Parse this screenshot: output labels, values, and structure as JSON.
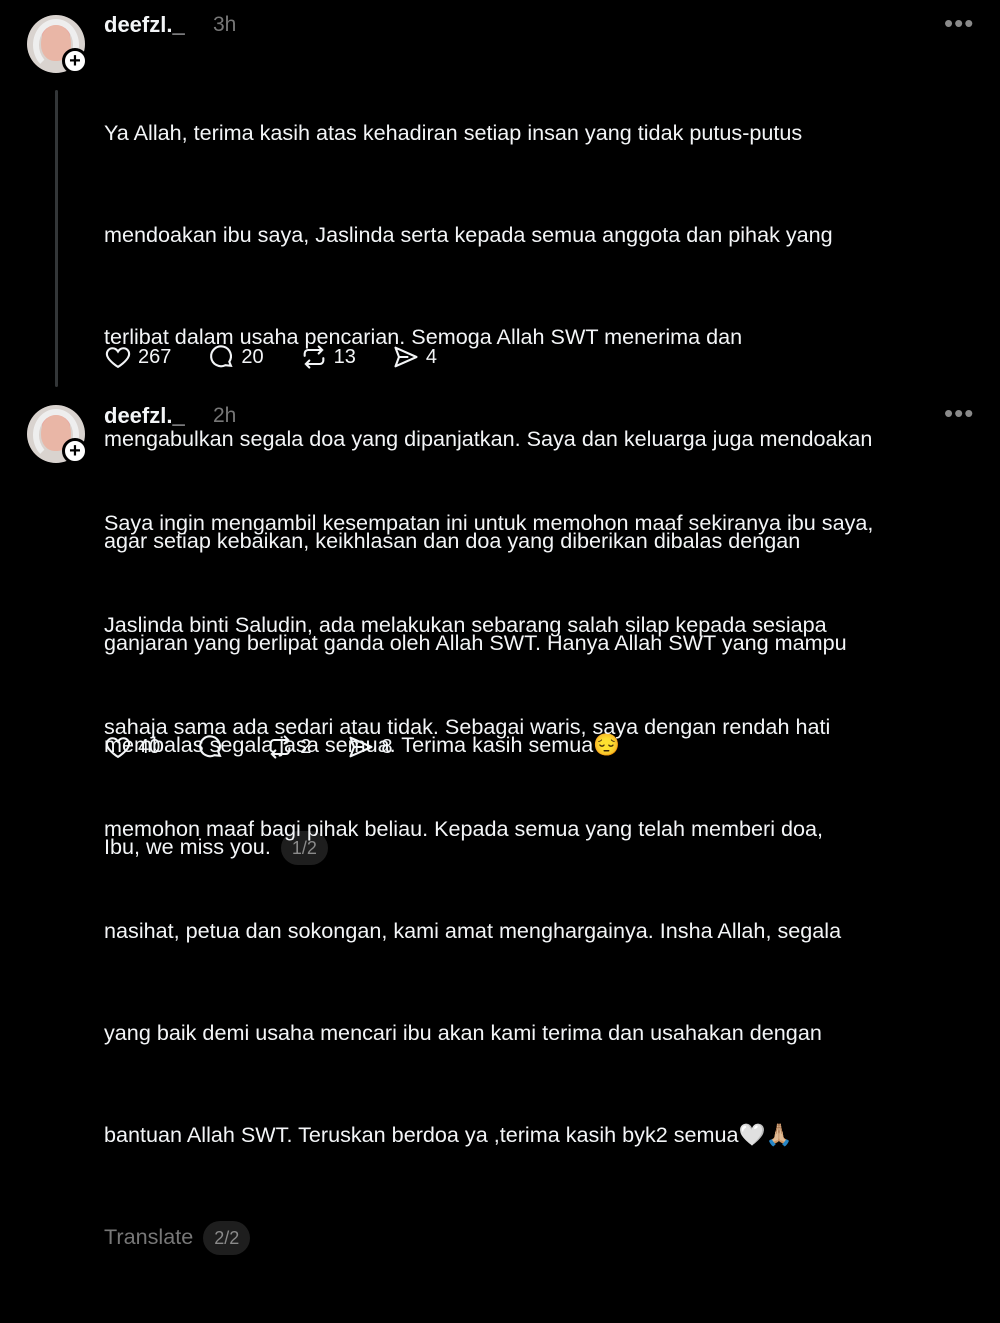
{
  "posts": [
    {
      "username": "deefzl._",
      "time": "3h",
      "more": "•••",
      "lines": [
        "Ya Allah, terima kasih atas kehadiran setiap insan yang tidak putus-putus",
        "mendoakan ibu saya, Jaslinda serta kepada semua anggota dan pihak yang",
        "terlibat dalam usaha pencarian. Semoga Allah SWT menerima dan",
        "mengabulkan segala doa yang dipanjatkan. Saya dan keluarga juga mendoakan",
        "agar setiap kebaikan, keikhlasan dan doa yang diberikan dibalas dengan",
        "ganjaran yang berlipat ganda oleh Allah SWT. Hanya Allah SWT yang mampu",
        "membalas segala jasa semua. Terima kasih semua😔",
        "Ibu, we miss you."
      ],
      "pager": "1/2",
      "likes": "267",
      "comments": "20",
      "reposts": "13",
      "shares": "4"
    },
    {
      "username": "deefzl._",
      "time": "2h",
      "more": "•••",
      "lines": [
        "Saya ingin mengambil kesempatan ini untuk memohon maaf sekiranya ibu saya,",
        "Jaslinda binti Saludin, ada melakukan sebarang salah silap kepada sesiapa",
        "sahaja sama ada sedari atau tidak. Sebagai waris, saya dengan rendah hati",
        "memohon maaf bagi pihak beliau. Kepada semua yang telah memberi doa,",
        "nasihat, petua dan sokongan, kami amat menghargainya. Insha Allah, segala",
        "yang baik demi usaha mencari ibu akan kami terima dan usahakan dengan",
        "bantuan Allah SWT. Teruskan berdoa ya ,terima kasih byk2 semua🤍🙏🏼"
      ],
      "translate": "Translate",
      "pager": "2/2",
      "likes": "40",
      "comments": "",
      "reposts": "2",
      "shares": "8"
    }
  ]
}
